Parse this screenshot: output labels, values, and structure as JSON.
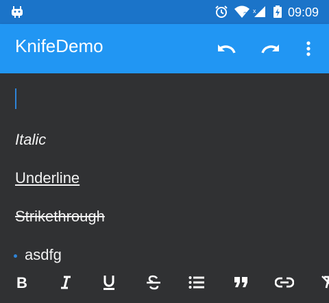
{
  "status_bar": {
    "time": "09:09",
    "icons": [
      "android-debug-icon",
      "alarm-icon",
      "wifi-icon",
      "signal-icon",
      "battery-charging-icon"
    ]
  },
  "app_bar": {
    "title": "KnifeDemo",
    "actions": [
      "undo-icon",
      "redo-icon",
      "more-vert-icon"
    ]
  },
  "editor": {
    "lines": {
      "italic": "Italic",
      "underline": "Underline",
      "strikethrough": "Strikethrough",
      "bullet": "asdfg"
    }
  },
  "toolbar": {
    "tools": [
      "bold-icon",
      "italic-icon",
      "underline-icon",
      "strikethrough-icon",
      "bullet-list-icon",
      "quote-icon",
      "link-icon",
      "clear-format-icon"
    ]
  },
  "colors": {
    "status_bar": "#1b74c9",
    "app_bar": "#2196f3",
    "background": "#303133",
    "cursor": "#2e84d8"
  }
}
